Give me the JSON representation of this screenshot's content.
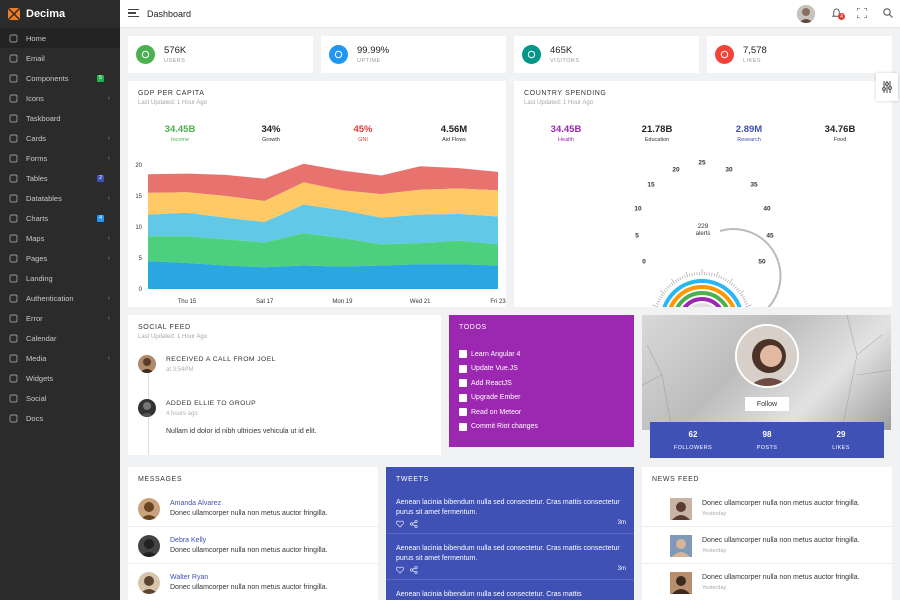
{
  "brand": {
    "name": "Decima"
  },
  "sidebar": {
    "items": [
      {
        "label": "Home",
        "icon": "home-icon"
      },
      {
        "label": "Email",
        "icon": "mail-icon"
      },
      {
        "label": "Components",
        "icon": "components-icon",
        "badge": "5",
        "badge_color": "#22b14c"
      },
      {
        "label": "Icons",
        "icon": "icons-icon",
        "chevron": true
      },
      {
        "label": "Taskboard",
        "icon": "taskboard-icon"
      },
      {
        "label": "Cards",
        "icon": "cards-icon",
        "chevron": true
      },
      {
        "label": "Forms",
        "icon": "forms-icon",
        "chevron": true
      },
      {
        "label": "Tables",
        "icon": "tables-icon",
        "badge": "2",
        "badge_color": "#3f51b5"
      },
      {
        "label": "Datatables",
        "icon": "datatables-icon",
        "chevron": true
      },
      {
        "label": "Charts",
        "icon": "charts-icon",
        "badge": "4",
        "badge_color": "#2196f3"
      },
      {
        "label": "Maps",
        "icon": "maps-icon",
        "chevron": true
      },
      {
        "label": "Pages",
        "icon": "pages-icon",
        "chevron": true
      },
      {
        "label": "Landing",
        "icon": "landing-icon"
      },
      {
        "label": "Authentication",
        "icon": "auth-icon",
        "chevron": true
      },
      {
        "label": "Error",
        "icon": "error-icon",
        "chevron": true
      },
      {
        "label": "Calendar",
        "icon": "calendar-icon"
      },
      {
        "label": "Media",
        "icon": "media-icon",
        "chevron": true
      },
      {
        "label": "Widgets",
        "icon": "widgets-icon"
      },
      {
        "label": "Social",
        "icon": "social-icon"
      },
      {
        "label": "Docs",
        "icon": "docs-icon"
      }
    ]
  },
  "topbar": {
    "title": "Dashboard",
    "notification_count": "4"
  },
  "stats": [
    {
      "value": "576K",
      "label": "USERS",
      "color": "#4caf50"
    },
    {
      "value": "99.99%",
      "label": "UPTIME",
      "color": "#2196f3"
    },
    {
      "value": "465K",
      "label": "VISITORS",
      "color": "#009688"
    },
    {
      "value": "7,578",
      "label": "LIKES",
      "color": "#f44336"
    }
  ],
  "gdp": {
    "title": "GDP PER CAPITA",
    "subtitle": "Last Updated: 1 Hour Ago",
    "kpis": [
      {
        "value": "34.45B",
        "label": "Income",
        "color": "#4caf50",
        "label_color": "#4caf50"
      },
      {
        "value": "34%",
        "label": "Growth",
        "color": "#222",
        "label_color": "#333"
      },
      {
        "value": "45%",
        "label": "GNI",
        "color": "#e53935",
        "label_color": "#e53935"
      },
      {
        "value": "4.56M",
        "label": "Aid Flows",
        "color": "#222",
        "label_color": "#333"
      }
    ]
  },
  "spending": {
    "title": "COUNTRY SPENDING",
    "subtitle": "Last Updated: 1 Hour Ago",
    "kpis": [
      {
        "value": "34.45B",
        "label": "Health",
        "color": "#9c27b0",
        "label_color": "#9c27b0"
      },
      {
        "value": "21.78B",
        "label": "Education",
        "color": "#222",
        "label_color": "#333"
      },
      {
        "value": "2.89M",
        "label": "Research",
        "color": "#3f51b5",
        "label_color": "#3f51b5"
      },
      {
        "value": "34.76B",
        "label": "Food",
        "color": "#222",
        "label_color": "#333"
      }
    ],
    "gauge": {
      "value": "229",
      "unit": "alerts",
      "ticks": [
        "0",
        "5",
        "10",
        "15",
        "20",
        "25",
        "30",
        "35",
        "40",
        "45",
        "50"
      ]
    }
  },
  "chart_data": {
    "type": "area",
    "categories": [
      "",
      "Thu 15",
      "",
      "Sat 17",
      "",
      "Mon 19",
      "",
      "Wed 21",
      "",
      "Fri 23"
    ],
    "ylim": [
      0,
      20
    ],
    "yticks": [
      0,
      5,
      10,
      15,
      20
    ],
    "stacked": true,
    "series": [
      {
        "color": "#2aa7e0",
        "values": [
          4.5,
          4.2,
          3.8,
          3.5,
          3.8,
          3.6,
          3.8,
          4.0,
          4.0,
          3.8
        ]
      },
      {
        "color": "#4cd07d",
        "values": [
          4.0,
          4.3,
          4.2,
          4.0,
          5.2,
          4.6,
          3.4,
          3.4,
          3.8,
          3.4
        ]
      },
      {
        "color": "#62c8e8",
        "values": [
          3.5,
          3.8,
          3.5,
          3.3,
          4.6,
          4.5,
          4.3,
          4.6,
          4.3,
          4.5
        ]
      },
      {
        "color": "#ffc966",
        "values": [
          3.5,
          3.3,
          3.5,
          3.4,
          3.6,
          3.2,
          3.8,
          4.0,
          4.1,
          4.2
        ]
      },
      {
        "color": "#e8736e",
        "values": [
          3.0,
          3.0,
          3.4,
          3.6,
          3.0,
          3.2,
          3.0,
          3.8,
          3.3,
          3.0
        ]
      }
    ]
  },
  "social_feed": {
    "title": "SOCIAL FEED",
    "subtitle": "Last Updated: 1 Hour Ago",
    "items": [
      {
        "text": "RECEIVED A CALL FROM JOEL",
        "time": "at 3:54PM"
      },
      {
        "text": "ADDED ELLIE TO GROUP",
        "time": "4 hours ago",
        "detail": "Nullam id dolor id nibh ultricies vehicula ut id elit."
      }
    ]
  },
  "todos": {
    "title": "TODOS",
    "items": [
      "Learn Angular 4",
      "Update Vue.JS",
      "Add ReactJS",
      "Upgrade Ember",
      "Read on Meteor",
      "Commit Riot changes"
    ]
  },
  "profile": {
    "follow_label": "Follow",
    "stats": [
      {
        "value": "62",
        "label": "FOLLOWERS"
      },
      {
        "value": "98",
        "label": "POSTS"
      },
      {
        "value": "29",
        "label": "LIKES"
      }
    ]
  },
  "messages": {
    "title": "MESSAGES",
    "items": [
      {
        "name": "Amanda Alvarez",
        "text": "Donec ullamcorper nulla non metus auctor fringilla."
      },
      {
        "name": "Debra Kelly",
        "text": "Donec ullamcorper nulla non metus auctor fringilla."
      },
      {
        "name": "Walter Ryan",
        "text": "Donec ullamcorper nulla non metus auctor fringilla."
      }
    ]
  },
  "tweets": {
    "title": "TWEETS",
    "items": [
      {
        "text": "Aenean lacinia bibendum nulla sed consectetur. Cras mattis consectetur purus sit amet fermentum.",
        "time": "3m"
      },
      {
        "text": "Aenean lacinia bibendum nulla sed consectetur. Cras mattis consectetur purus sit amet fermentum.",
        "time": "3m"
      },
      {
        "text": "Aenean lacinia bibendum nulla sed consectetur. Cras mattis",
        "time": ""
      }
    ]
  },
  "news": {
    "title": "NEWS FEED",
    "items": [
      {
        "text": "Donec ullamcorper nulla non metus auctor fringilla.",
        "time": "Yesterday"
      },
      {
        "text": "Donec ullamcorper nulla non metus auctor fringilla.",
        "time": "Yesterday"
      },
      {
        "text": "Donec ullamcorper nulla non metus auctor fringilla.",
        "time": "Yesterday"
      }
    ]
  }
}
